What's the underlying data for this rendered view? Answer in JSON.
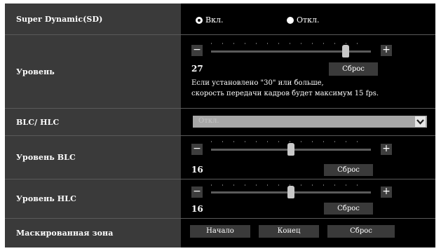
{
  "sd": {
    "label": "Super Dynamic(SD)",
    "options": [
      {
        "label": "Вкл.",
        "checked": true
      },
      {
        "label": "Откл.",
        "checked": false
      }
    ]
  },
  "level": {
    "label": "Уровень",
    "value": "27",
    "max": 32,
    "reset_label": "Сброс",
    "note_line1": "Если установлено \"30\" или больше,",
    "note_line2": "скорость передачи кадров будет максимум 15 fps.",
    "minus": "−",
    "plus": "+"
  },
  "blc_hlc": {
    "label": "BLC/ HLC",
    "selected": "Откл.",
    "arrow": "chevron-down-icon"
  },
  "blc_level": {
    "label": "Уровень BLC",
    "value": "16",
    "max": 32,
    "reset_label": "Сброс",
    "minus": "−",
    "plus": "+"
  },
  "hlc_level": {
    "label": "Уровень HLC",
    "value": "16",
    "max": 32,
    "reset_label": "Сброс",
    "minus": "−",
    "plus": "+"
  },
  "mask": {
    "label": "Маскированная зона",
    "start_label": "Начало",
    "end_label": "Конец",
    "reset_label": "Сброс"
  },
  "colors": {
    "panel": "#000000",
    "label_bg": "#3a3a3a",
    "track": "#5b5b5b",
    "thumb": "#c8c8c8",
    "select": "#a7a7a7"
  }
}
